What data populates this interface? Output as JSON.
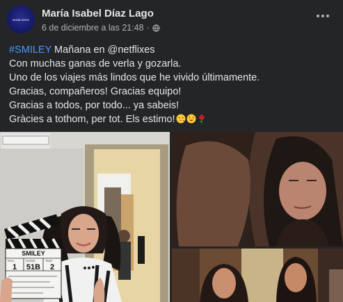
{
  "post": {
    "author": "María Isabel Díaz Lago",
    "avatar_text": "ISABLISSIX",
    "timestamp": "6 de diciembre a las 21:48",
    "separator": "·",
    "privacy_icon": "globe-icon",
    "more_icon": "more-options-icon",
    "hashtag": "#SMILEY",
    "lines": [
      "Mañana en @netflixes",
      "Con muchas ganas de verla y gozarla.",
      "Uno de los viajes más lindos que he vivido últimamente.",
      "Gracias, compañeros! Gracias equipo!",
      "Gracias a todos, por todo... ya sabeis!",
      "Gràcies a tothom, per tot.  Els estimo!"
    ],
    "emojis": [
      "face-blowing-kiss-icon",
      "heart-eyes-icon",
      "rose-icon"
    ]
  },
  "photos": {
    "clapper": {
      "title": "SMILEY",
      "roll": "ROLL",
      "scene": "SCENE",
      "take": "TAKE",
      "roll_value": "1",
      "scene_value": "51B",
      "take_value": "2"
    }
  },
  "colors": {
    "background": "#242526",
    "text": "#e4e6eb",
    "secondary_text": "#b0b3b8",
    "hashtag": "#4599ff"
  }
}
